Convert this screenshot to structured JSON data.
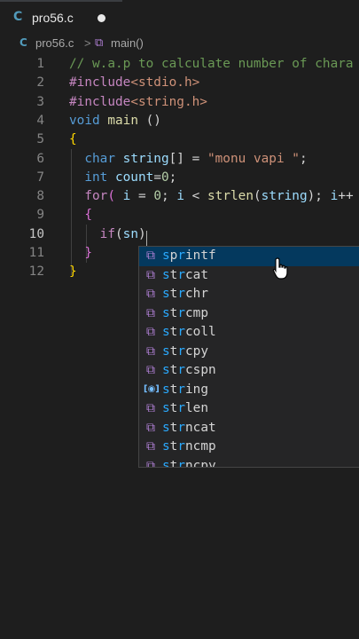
{
  "tab": {
    "icon": "C",
    "title": "pro56.c"
  },
  "breadcrumb": {
    "icon": "C",
    "file": "pro56.c",
    "separator": ">",
    "symbol": "main()"
  },
  "lines": [
    {
      "n": "1",
      "tokens": [
        {
          "t": "// w.a.p to calculate number of chara",
          "c": "cmt"
        }
      ]
    },
    {
      "n": "2",
      "tokens": [
        {
          "t": "#include",
          "c": "pre"
        },
        {
          "t": "<stdio.h>",
          "c": "str"
        }
      ]
    },
    {
      "n": "3",
      "tokens": [
        {
          "t": "#include",
          "c": "pre"
        },
        {
          "t": "<string.h>",
          "c": "str"
        }
      ]
    },
    {
      "n": "4",
      "tokens": [
        {
          "t": "void ",
          "c": "kw"
        },
        {
          "t": "main",
          "c": "fnc"
        },
        {
          "t": " ()",
          "c": ""
        }
      ]
    },
    {
      "n": "5",
      "tokens": [
        {
          "t": "{",
          "c": "brace"
        }
      ]
    },
    {
      "n": "6",
      "tokens": [
        {
          "t": "  ",
          "c": ""
        },
        {
          "t": "char ",
          "c": "kw"
        },
        {
          "t": "string",
          "c": "var"
        },
        {
          "t": "[] = ",
          "c": ""
        },
        {
          "t": "\"monu vapi \"",
          "c": "str"
        },
        {
          "t": ";",
          "c": ""
        }
      ]
    },
    {
      "n": "7",
      "tokens": [
        {
          "t": "  ",
          "c": ""
        },
        {
          "t": "int ",
          "c": "kw"
        },
        {
          "t": "count",
          "c": "var"
        },
        {
          "t": "=",
          "c": ""
        },
        {
          "t": "0",
          "c": "num"
        },
        {
          "t": ";",
          "c": ""
        }
      ]
    },
    {
      "n": "8",
      "tokens": [
        {
          "t": "  ",
          "c": ""
        },
        {
          "t": "for",
          "c": "pre"
        },
        {
          "t": "( ",
          "c": "paren2"
        },
        {
          "t": "i",
          "c": "var"
        },
        {
          "t": " = ",
          "c": ""
        },
        {
          "t": "0",
          "c": "num"
        },
        {
          "t": "; ",
          "c": ""
        },
        {
          "t": "i",
          "c": "var"
        },
        {
          "t": " < ",
          "c": ""
        },
        {
          "t": "strlen",
          "c": "fnc"
        },
        {
          "t": "(",
          "c": ""
        },
        {
          "t": "string",
          "c": "var"
        },
        {
          "t": "); ",
          "c": ""
        },
        {
          "t": "i",
          "c": "var"
        },
        {
          "t": "++",
          "c": ""
        }
      ]
    },
    {
      "n": "9",
      "tokens": [
        {
          "t": "  ",
          "c": ""
        },
        {
          "t": "{",
          "c": "paren2"
        }
      ]
    },
    {
      "n": "10",
      "tokens": [
        {
          "t": "    ",
          "c": ""
        },
        {
          "t": "if",
          "c": "pre"
        },
        {
          "t": "(",
          "c": ""
        },
        {
          "t": "sn",
          "c": "var"
        },
        {
          "t": ")",
          "c": ""
        }
      ]
    },
    {
      "n": "11",
      "tokens": [
        {
          "t": "  ",
          "c": ""
        },
        {
          "t": "}",
          "c": "paren2"
        }
      ]
    },
    {
      "n": "12",
      "tokens": [
        {
          "t": "}",
          "c": "brace"
        }
      ]
    }
  ],
  "suggestions": [
    {
      "label": "sprintf",
      "kind": "method-cube-icon",
      "selected": true
    },
    {
      "label": "strcat",
      "kind": "method-cube-icon"
    },
    {
      "label": "strchr",
      "kind": "method-cube-icon"
    },
    {
      "label": "strcmp",
      "kind": "method-cube-icon"
    },
    {
      "label": "strcoll",
      "kind": "method-cube-icon"
    },
    {
      "label": "strcpy",
      "kind": "method-cube-icon"
    },
    {
      "label": "strcspn",
      "kind": "method-cube-icon"
    },
    {
      "label": "string",
      "kind": "variable-icon"
    },
    {
      "label": "strlen",
      "kind": "method-cube-icon"
    },
    {
      "label": "strncat",
      "kind": "method-cube-icon"
    },
    {
      "label": "strncmp",
      "kind": "method-cube-icon"
    },
    {
      "label": "strncpy",
      "kind": "method-cube-icon"
    }
  ],
  "active_line": "10",
  "colors": {
    "background": "#1e1e1e",
    "selection": "#04395e",
    "match_highlight": "#2aaaff"
  }
}
